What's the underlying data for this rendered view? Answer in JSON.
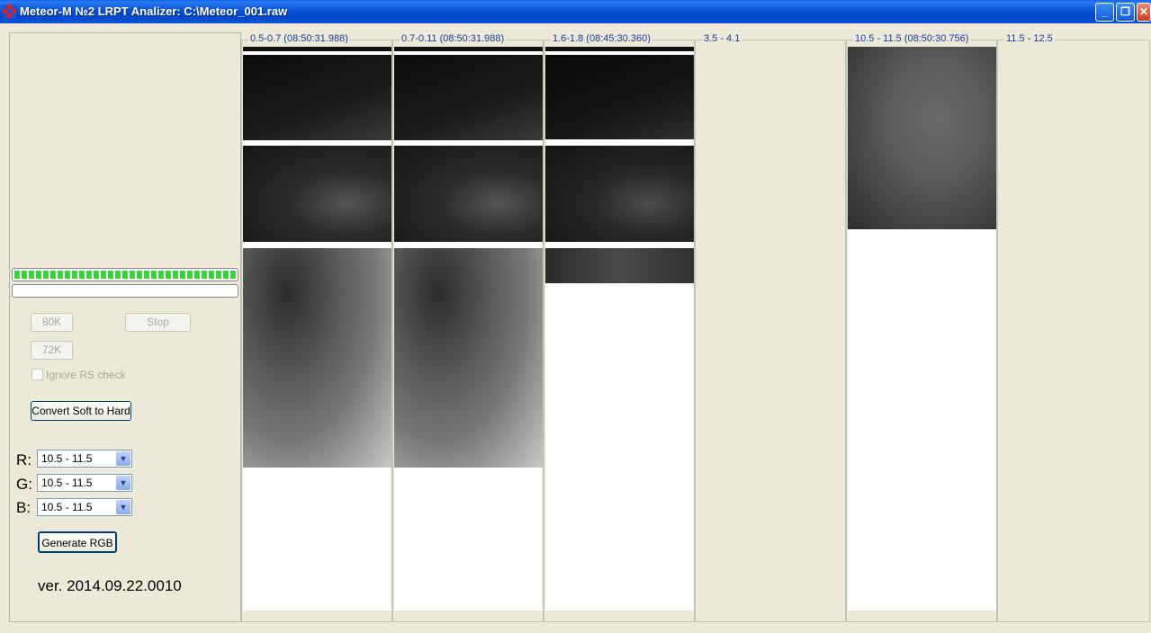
{
  "window": {
    "title": "Meteor-M №2 LRPT Analizer: C:\\Meteor_001.raw",
    "minimize": "_",
    "restore": "❐",
    "close": "✕"
  },
  "progress": {
    "main_fraction": 1.0,
    "secondary_fraction": 0.0
  },
  "controls": {
    "btn_80k": "80K",
    "btn_stop": "Stop",
    "btn_72k": "72K",
    "ignore_rs_label": "Ignore RS check",
    "ignore_rs_checked": false,
    "convert_label": "Convert Soft to Hard"
  },
  "rgb": {
    "r_label": "R:",
    "r_value": "10.5 - 11.5",
    "g_label": "G:",
    "g_value": "10.5 - 11.5",
    "b_label": "B:",
    "b_value": "10.5 - 11.5",
    "generate_label": "Generate RGB"
  },
  "version": "ver. 2014.09.22.0010",
  "channels": [
    {
      "label": "0.5-0.7 (08:50:31.988)"
    },
    {
      "label": "0.7-0.11 (08:50:31.988)"
    },
    {
      "label": "1.6-1.8 (08:45:30.360)"
    },
    {
      "label": "3.5 - 4.1"
    },
    {
      "label": "10.5 - 11.5 (08:50:30.756)"
    },
    {
      "label": "11.5 - 12.5"
    }
  ]
}
